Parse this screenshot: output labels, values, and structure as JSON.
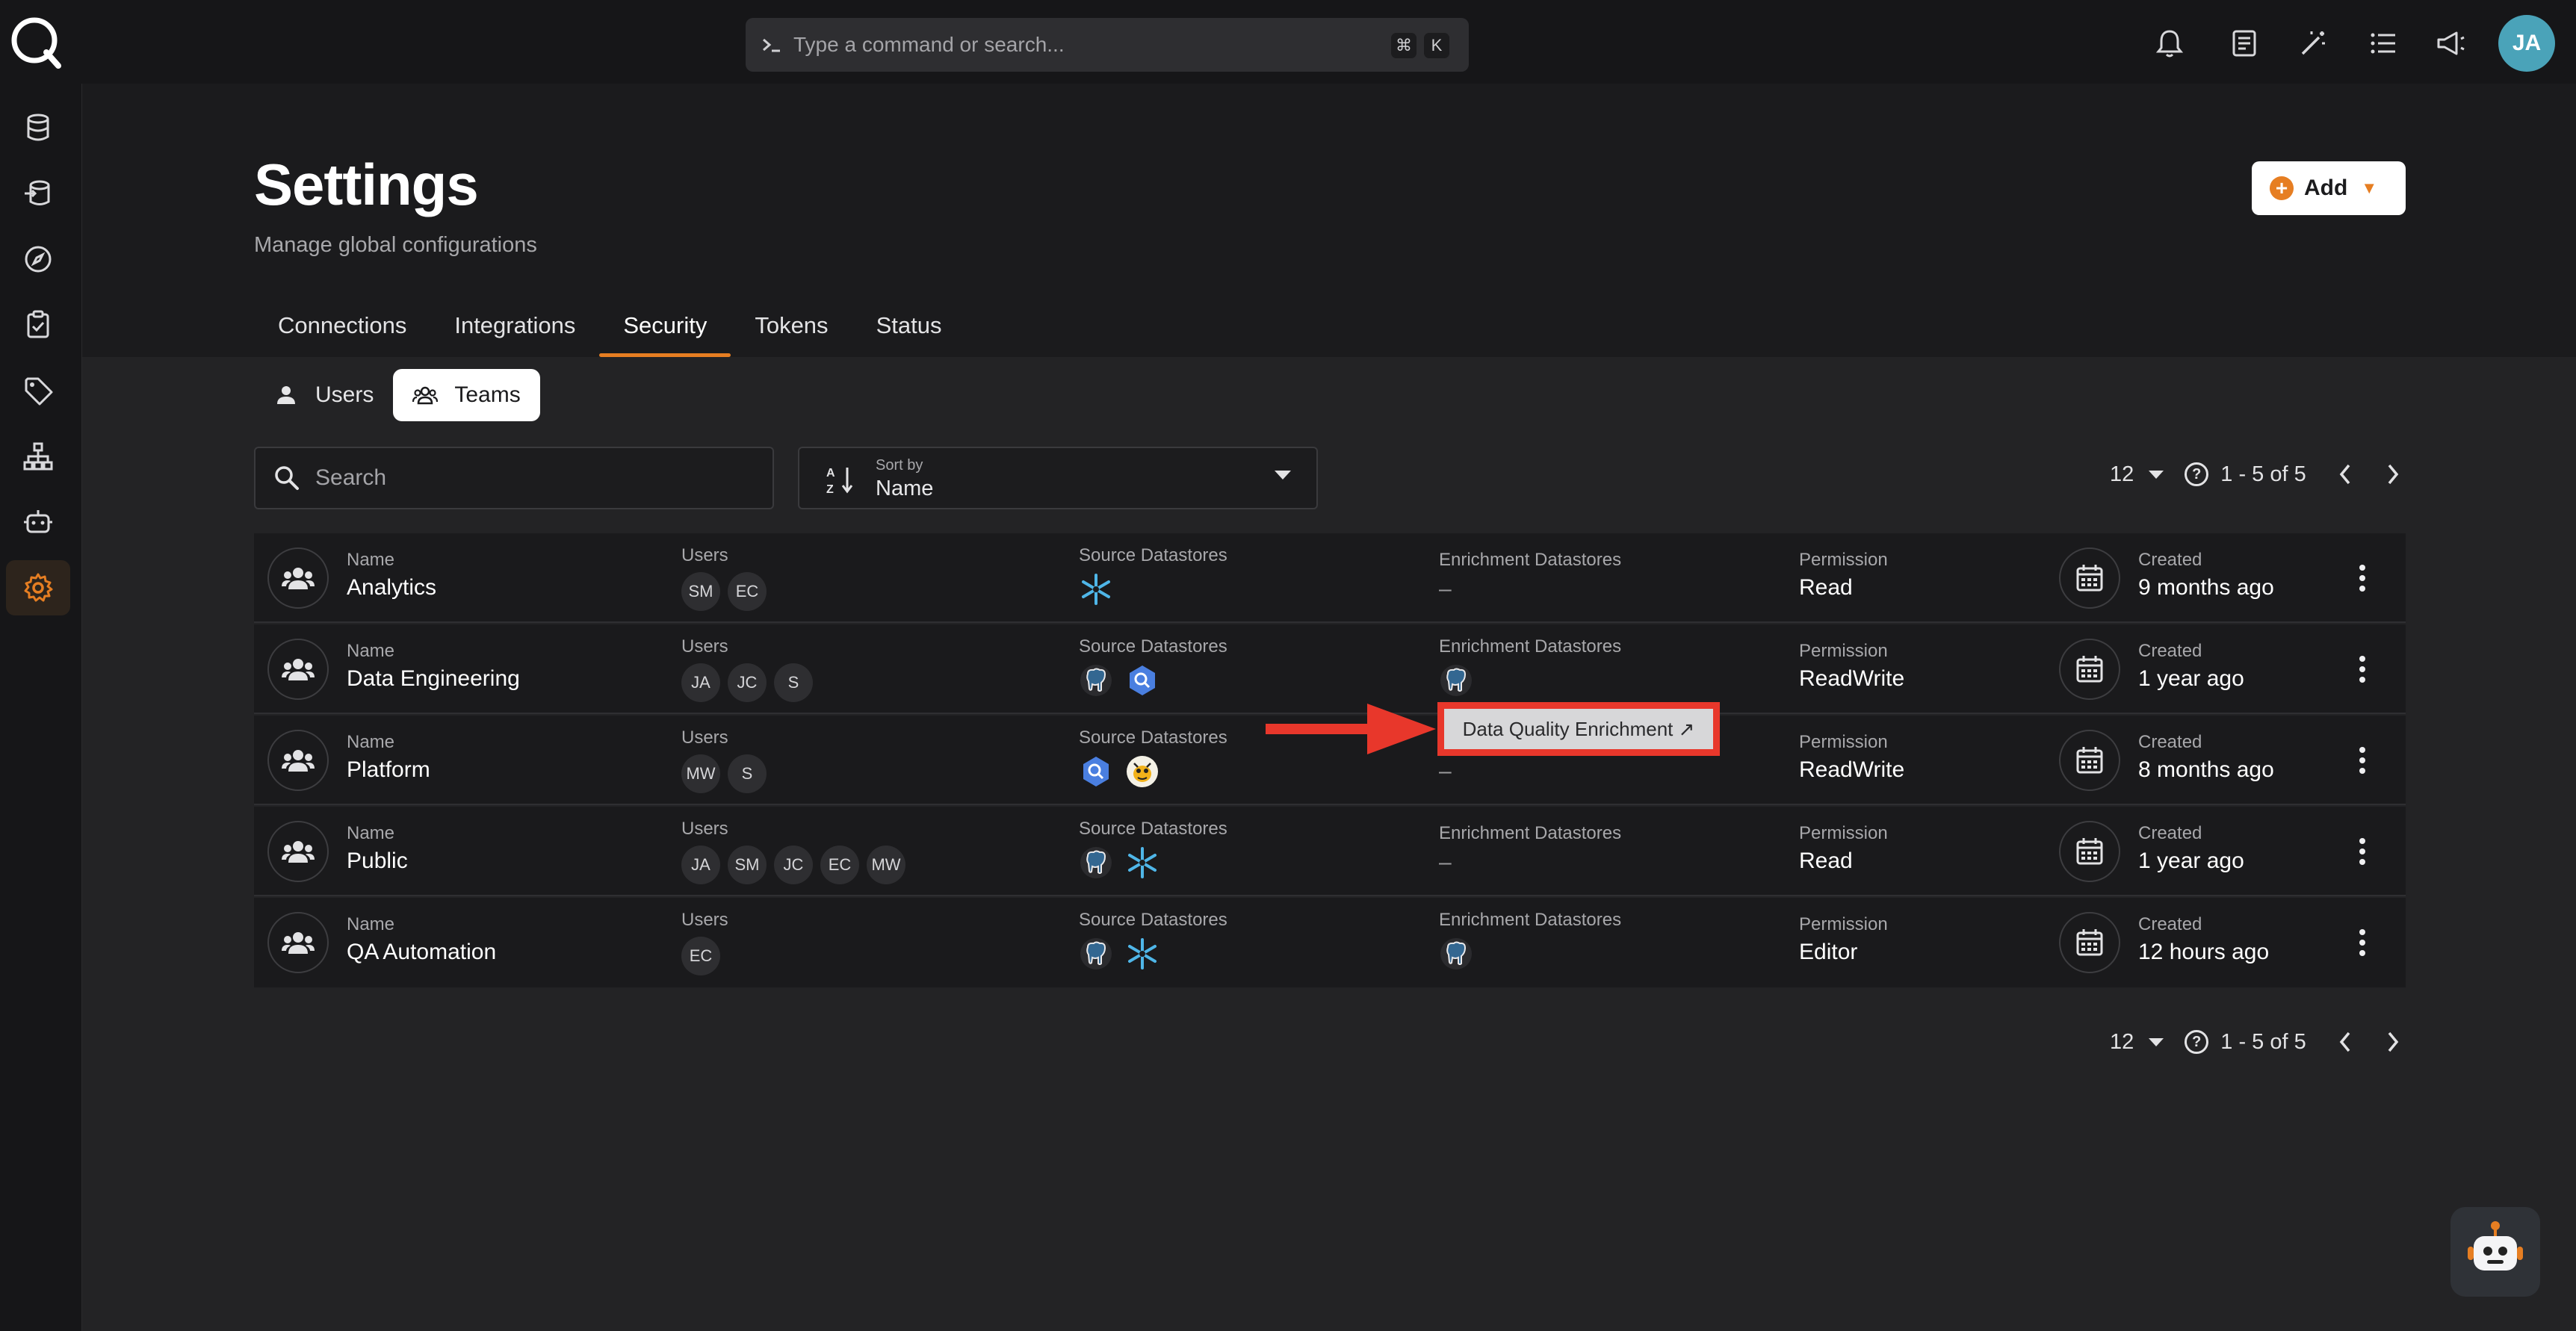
{
  "command": {
    "placeholder": "Type a command or search...",
    "kbd1": "⌘",
    "kbd2": "K"
  },
  "user": {
    "initials": "JA"
  },
  "page": {
    "title": "Settings",
    "subtitle": "Manage global configurations",
    "add_label": "Add"
  },
  "tabs": [
    "Connections",
    "Integrations",
    "Security",
    "Tokens",
    "Status"
  ],
  "active_tab": "Security",
  "segments": {
    "users": "Users",
    "teams": "Teams"
  },
  "search": {
    "placeholder": "Search"
  },
  "sort": {
    "label": "Sort by",
    "value": "Name"
  },
  "pager": {
    "size": "12",
    "range": "1 - 5 of 5"
  },
  "columns": {
    "name": "Name",
    "users": "Users",
    "source": "Source Datastores",
    "enrichment": "Enrichment Datastores",
    "permission": "Permission",
    "created": "Created"
  },
  "teams": [
    {
      "name": "Analytics",
      "users": [
        "SM",
        "EC"
      ],
      "source": [
        "snowflake"
      ],
      "enrichment": [],
      "enrichment_text": "–",
      "permission": "Read",
      "created": "9 months ago"
    },
    {
      "name": "Data Engineering",
      "users": [
        "JA",
        "JC",
        "S"
      ],
      "source": [
        "postgres",
        "bigquery"
      ],
      "enrichment": [
        "postgres"
      ],
      "enrichment_text": "",
      "permission": "ReadWrite",
      "created": "1 year ago"
    },
    {
      "name": "Platform",
      "users": [
        "MW",
        "S"
      ],
      "source": [
        "bigquery",
        "hive"
      ],
      "enrichment": [],
      "enrichment_text": "–",
      "permission": "ReadWrite",
      "created": "8 months ago"
    },
    {
      "name": "Public",
      "users": [
        "JA",
        "SM",
        "JC",
        "EC",
        "MW"
      ],
      "source": [
        "postgres",
        "snowflake"
      ],
      "enrichment": [],
      "enrichment_text": "–",
      "permission": "Read",
      "created": "1 year ago"
    },
    {
      "name": "QA Automation",
      "users": [
        "EC"
      ],
      "source": [
        "postgres",
        "snowflake"
      ],
      "enrichment": [
        "postgres"
      ],
      "enrichment_text": "",
      "permission": "Editor",
      "created": "12 hours ago"
    }
  ],
  "tooltip": {
    "text": "Data Quality Enrichment ↗"
  },
  "colors": {
    "accent": "#e67e22",
    "annotation": "#e8372b",
    "avatar": "#4aa3b9"
  }
}
